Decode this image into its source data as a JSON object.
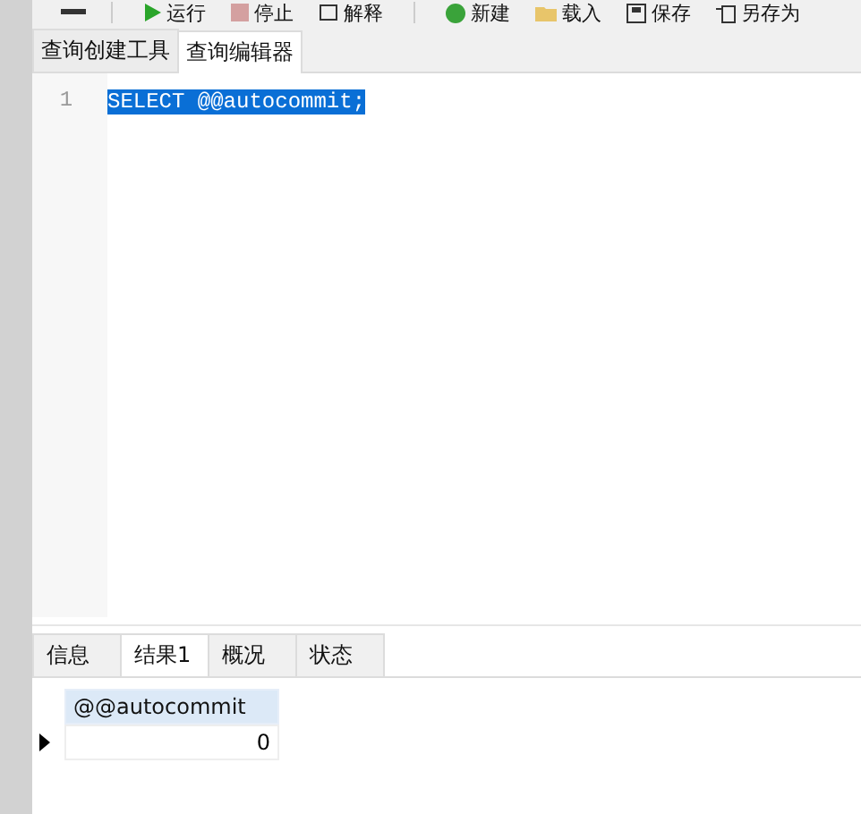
{
  "toolbar": [
    {
      "kind": "run",
      "label": "运行"
    },
    {
      "kind": "stop",
      "label": "停止"
    },
    {
      "kind": "explain",
      "label": "解释"
    },
    {
      "kind": "new",
      "label": "新建"
    },
    {
      "kind": "load",
      "label": "载入"
    },
    {
      "kind": "save",
      "label": "保存"
    },
    {
      "kind": "saveas",
      "label": "另存为"
    }
  ],
  "tabs": [
    {
      "label": "查询创建工具",
      "selected": false
    },
    {
      "label": "查询编辑器",
      "selected": true
    }
  ],
  "editor": {
    "lines": [
      {
        "number": "1",
        "code": "SELECT @@autocommit;",
        "selected": true
      }
    ]
  },
  "result_tabs": [
    {
      "label": "信息",
      "selected": false
    },
    {
      "label": "结果1",
      "selected": true
    },
    {
      "label": "概况",
      "selected": false
    },
    {
      "label": "状态",
      "selected": false
    }
  ],
  "table": {
    "columns": [
      "@@autocommit"
    ],
    "rows": [
      {
        "current": true,
        "cells": [
          "0"
        ]
      }
    ]
  }
}
